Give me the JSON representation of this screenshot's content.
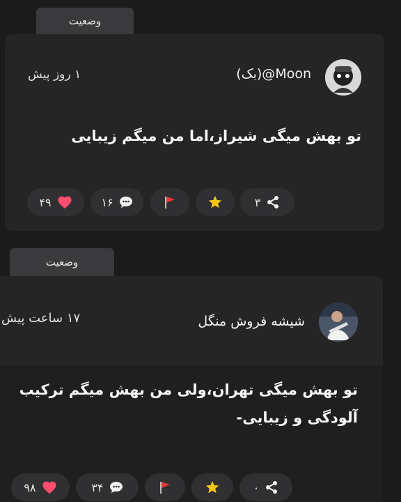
{
  "posts": [
    {
      "tab_label": "وضعیت",
      "username": "Moon@(بک)",
      "time": "۱ روز پیش",
      "text": "تو بهش میگی شیراز،اما من میگم زیبایی",
      "likes": "۴۹",
      "comments": "۱۶",
      "shares": "۳"
    },
    {
      "tab_label": "وضعیت",
      "username": "شیشه فروش منگل",
      "time": "۱۷ ساعت پیش",
      "text": "تو بهش میگی تهران،ولی من بهش میگم ترکیب آلودگی و زیبایی-",
      "likes": "۹۸",
      "comments": "۳۴",
      "shares": "۰"
    }
  ],
  "icons": {
    "like": "heart-icon",
    "comment": "chat-bubble-icon",
    "report": "flag-icon",
    "favorite": "star-icon",
    "share": "share-icon"
  },
  "colors": {
    "heart": "#ff4d6d",
    "flag": "#e53935",
    "star": "#f5c518"
  }
}
